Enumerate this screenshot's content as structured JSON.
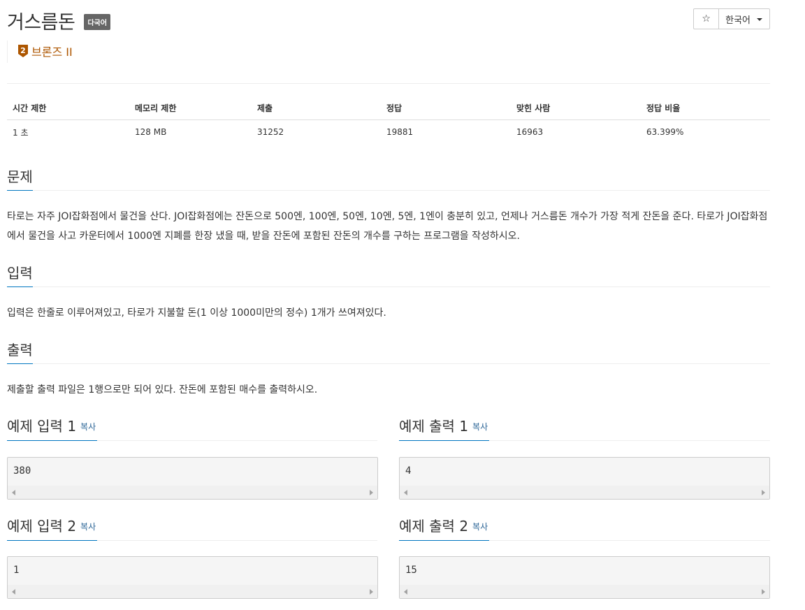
{
  "problem": {
    "title": "거스름돈",
    "lang_badge": "다국어",
    "tier": {
      "label": "브론즈 II",
      "number": "2",
      "color": "#ad5600"
    }
  },
  "actions": {
    "star_icon": "☆",
    "language": "한국어"
  },
  "stats": {
    "headers": [
      "시간 제한",
      "메모리 제한",
      "제출",
      "정답",
      "맞힌 사람",
      "정답 비율"
    ],
    "values": [
      "1 초",
      "128 MB",
      "31252",
      "19881",
      "16963",
      "63.399%"
    ]
  },
  "sections": {
    "problem": {
      "title": "문제",
      "text": "타로는 자주 JOI잡화점에서 물건을 산다. JOI잡화점에는 잔돈으로 500엔, 100엔, 50엔, 10엔, 5엔, 1엔이 충분히 있고, 언제나 거스름돈 개수가 가장 적게 잔돈을 준다. 타로가 JOI잡화점에서 물건을 사고 카운터에서 1000엔 지폐를 한장 냈을 때, 받을 잔돈에 포함된 잔돈의 개수를 구하는 프로그램을 작성하시오."
    },
    "input": {
      "title": "입력",
      "text": "입력은 한줄로 이루어져있고, 타로가 지불할 돈(1 이상 1000미만의 정수) 1개가 쓰여져있다."
    },
    "output": {
      "title": "출력",
      "text": "제출할 출력 파일은 1행으로만 되어 있다. 잔돈에 포함된 매수를 출력하시오."
    }
  },
  "samples": {
    "copy_label": "복사",
    "input1": {
      "title": "예제 입력 1",
      "value": "380"
    },
    "output1": {
      "title": "예제 출력 1",
      "value": "4"
    },
    "input2": {
      "title": "예제 입력 2",
      "value": "1"
    },
    "output2": {
      "title": "예제 출력 2",
      "value": "15"
    }
  },
  "colors": {
    "accent": "#0076c0",
    "link": "#2a6496",
    "tier_bronze": "#ad5600"
  }
}
